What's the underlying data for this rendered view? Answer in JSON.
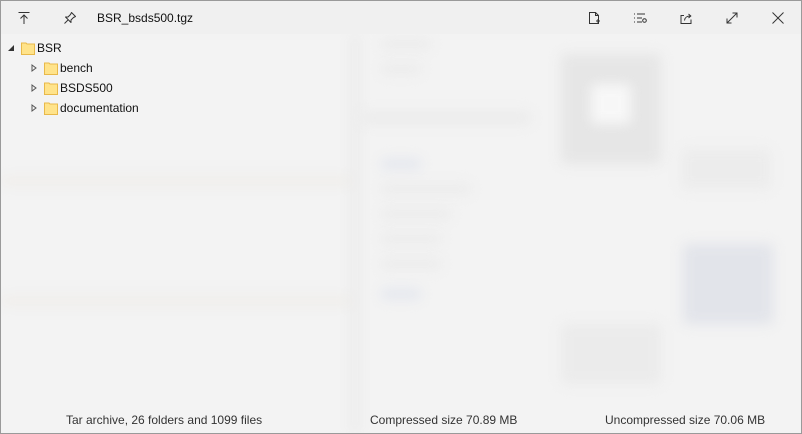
{
  "window": {
    "title": "BSR_bsds500.tgz"
  },
  "toolbar": {
    "icons": [
      "pin-top-icon",
      "pin-icon",
      "open-file-icon",
      "list-settings-icon",
      "share-icon",
      "maximize-icon",
      "close-icon"
    ]
  },
  "tree": {
    "root": {
      "label": "BSR",
      "expanded": true
    },
    "children": [
      {
        "label": "bench",
        "expanded": false
      },
      {
        "label": "BSDS500",
        "expanded": false
      },
      {
        "label": "documentation",
        "expanded": false
      }
    ]
  },
  "status": {
    "summary": "Tar archive, 26 folders and 1099 files",
    "compressed": "Compressed size 70.89 MB",
    "uncompressed": "Uncompressed size 70.06 MB"
  },
  "colors": {
    "folder_fill": "#FFE38A",
    "folder_edge": "#E8B94A",
    "background": "#f3f3f3"
  }
}
